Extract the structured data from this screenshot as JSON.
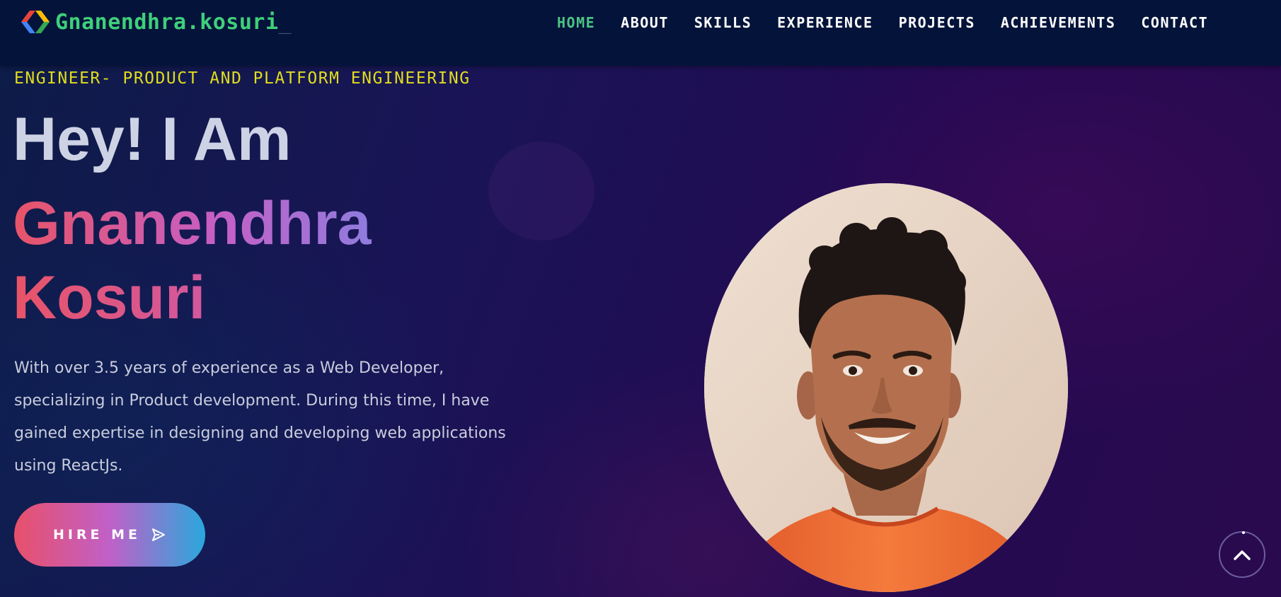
{
  "header": {
    "brand": "Gnanendhra.kosuri",
    "brand_cursor": "_",
    "logo_icon": "chevrons-code-icon",
    "nav": [
      {
        "label": "HOME",
        "active": true
      },
      {
        "label": "ABOUT",
        "active": false
      },
      {
        "label": "SKILLS",
        "active": false
      },
      {
        "label": "EXPERIENCE",
        "active": false
      },
      {
        "label": "PROJECTS",
        "active": false
      },
      {
        "label": "ACHIEVEMENTS",
        "active": false
      },
      {
        "label": "CONTACT",
        "active": false
      }
    ]
  },
  "hero": {
    "role": "ENGINEER- PRODUCT AND PLATFORM ENGINEERING",
    "greeting": "Hey! I Am",
    "first_name": "Gnanendhra",
    "last_name": "Kosuri",
    "bio": "With over 3.5 years of experience as a Web Developer, specializing in Product development. During this time, I have gained expertise in designing and developing web applications using ReactJs.",
    "cta_label": "HIRE ME",
    "cta_icon": "send-icon"
  },
  "scroll_top_icon": "chevron-up-icon",
  "colors": {
    "nav_bg": "#04133a",
    "brand": "#3fcf7a",
    "nav_active": "#4cc585",
    "role": "#e0dc1e",
    "gradient_start": "#e8506a",
    "gradient_mid": "#c060c8",
    "gradient_end": "#2aa8dc"
  }
}
